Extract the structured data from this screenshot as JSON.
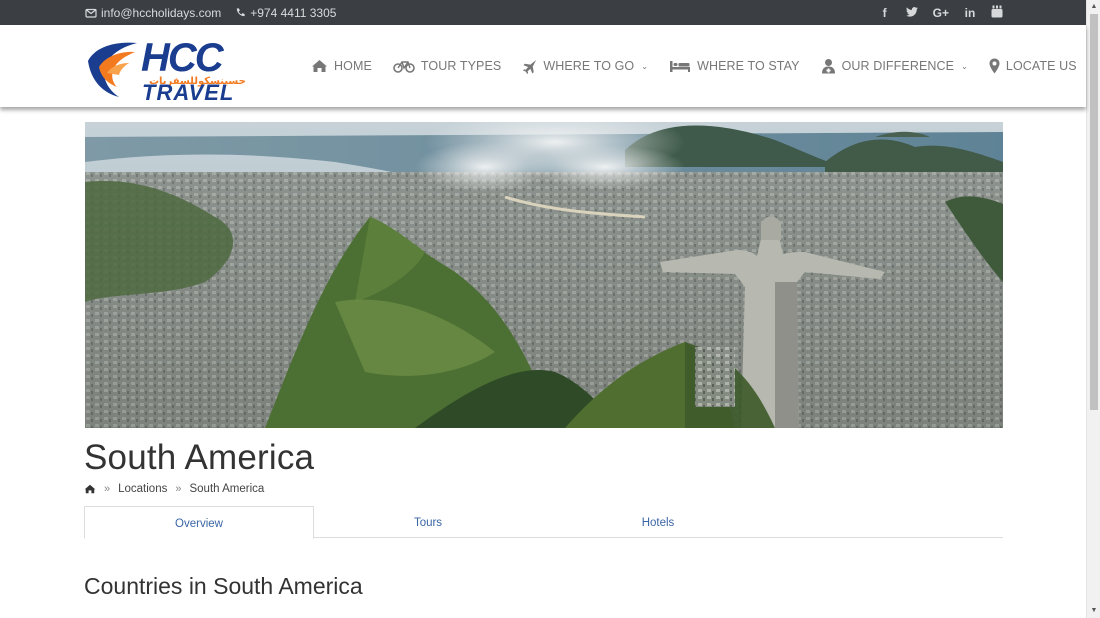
{
  "topbar": {
    "email": "info@hccholidays.com",
    "phone": "+974 4411 3305",
    "social": [
      {
        "icon": "facebook-icon",
        "glyph": "f"
      },
      {
        "icon": "twitter-icon",
        "glyph": "t"
      },
      {
        "icon": "google-plus-icon",
        "glyph": "G+"
      },
      {
        "icon": "linkedin-icon",
        "glyph": "in"
      },
      {
        "icon": "youtube-icon",
        "glyph": "▶"
      }
    ]
  },
  "logo": {
    "top_text": "HCC",
    "arabic_text": "حسينسكوللسفريات",
    "bottom_text": "TRAVEL"
  },
  "nav": [
    {
      "label": "HOME",
      "icon": "home-icon",
      "dropdown": false
    },
    {
      "label": "TOUR TYPES",
      "icon": "bicycle-icon",
      "dropdown": false
    },
    {
      "label": "WHERE TO GO",
      "icon": "plane-icon",
      "dropdown": true
    },
    {
      "label": "WHERE TO STAY",
      "icon": "bed-icon",
      "dropdown": false
    },
    {
      "label": "OUR DIFFERENCE",
      "icon": "user-doctor-icon",
      "dropdown": true
    },
    {
      "label": "LOCATE US",
      "icon": "map-pin-icon",
      "dropdown": false
    }
  ],
  "page": {
    "title": "South America",
    "breadcrumb": [
      "Locations",
      "South America"
    ],
    "tabs": [
      "Overview",
      "Tours",
      "Hotels"
    ],
    "active_tab": "Overview",
    "section_title": "Countries in South America"
  },
  "colors": {
    "topbar_bg": "#3b3f44",
    "nav_text": "#777777",
    "tab_link": "#3a66a5",
    "logo_blue": "#1a3d8f",
    "logo_orange": "#f47a20"
  }
}
